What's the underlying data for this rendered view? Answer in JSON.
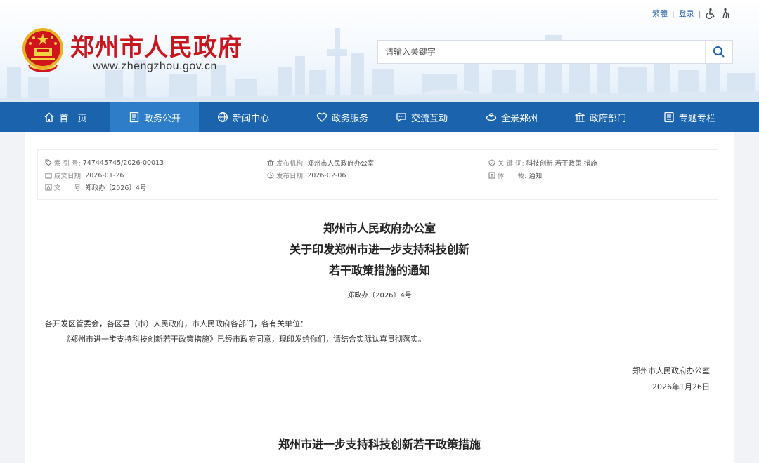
{
  "header": {
    "site_title": "郑州市人民政府",
    "site_domain": "www.zhengzhou.gov.cn",
    "top_links": {
      "traditional": "繁體",
      "login": "登录"
    },
    "search": {
      "placeholder": "请输入关键字",
      "icon": "search-icon"
    }
  },
  "nav": {
    "items": [
      {
        "label": "首　页",
        "icon": "home-icon"
      },
      {
        "label": "政务公开",
        "icon": "document-icon",
        "active": true
      },
      {
        "label": "新闻中心",
        "icon": "globe-icon"
      },
      {
        "label": "政务服务",
        "icon": "heart-icon"
      },
      {
        "label": "交流互动",
        "icon": "chat-icon"
      },
      {
        "label": "全景郑州",
        "icon": "panorama-icon"
      },
      {
        "label": "政府部门",
        "icon": "building-icon"
      },
      {
        "label": "专题专栏",
        "icon": "list-icon"
      }
    ]
  },
  "meta": {
    "index_no": {
      "key": "索 引 号:",
      "value": "747445745/2026-00013"
    },
    "publisher": {
      "key": "发布机构:",
      "value": "郑州市人民政府办公室"
    },
    "keywords": {
      "key": "关 键 词:",
      "value": "科技创新,若干政策,措施"
    },
    "created": {
      "key": "成文日期:",
      "value": "2026-01-26"
    },
    "published": {
      "key": "发布日期:",
      "value": "2026-02-06"
    },
    "genre": {
      "key": "体　　裁:",
      "value": "通知"
    },
    "doc_no": {
      "key": "文　　号:",
      "value": "郑政办〔2026〕4号"
    }
  },
  "document": {
    "title_line1": "郑州市人民政府办公室",
    "title_line2": "关于印发郑州市进一步支持科技创新",
    "title_line3": "若干政策措施的通知",
    "doc_number": "郑政办〔2026〕4号",
    "salutation": "各开发区管委会，各区县（市）人民政府，市人民政府各部门，各有关单位：",
    "body": "《郑州市进一步支持科技创新若干政策措施》已经市政府同意，现印发给你们，请结合实际认真贯彻落实。",
    "signatory": "郑州市人民政府办公室",
    "sign_date": "2026年1月26日",
    "section_title": "郑州市进一步支持科技创新若干政策措施"
  },
  "colors": {
    "nav_bg": "#1b64ad",
    "nav_active": "#2e7dc8",
    "title_red": "#c8161d",
    "link_blue": "#2b63a8"
  }
}
